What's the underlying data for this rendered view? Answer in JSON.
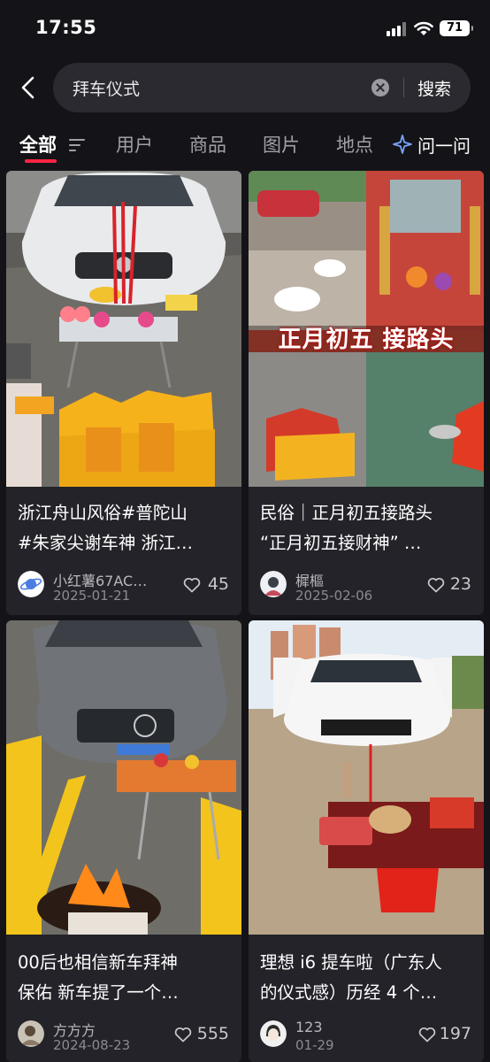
{
  "status_bar": {
    "time": "17:55",
    "battery": "71"
  },
  "search": {
    "query": "拜车仪式",
    "button_label": "搜索"
  },
  "tabs": [
    {
      "label": "全部"
    },
    {
      "label": "用户"
    },
    {
      "label": "商品"
    },
    {
      "label": "图片"
    },
    {
      "label": "地点"
    }
  ],
  "ask_button": {
    "label": "问一问"
  },
  "image_overlay_text": "正月初五 接路头",
  "cards": [
    {
      "title_line1": "浙江舟山风俗#普陀山",
      "title_line2": "#朱家尖谢车神 浙江…",
      "author": "小红薯67AC…",
      "date": "2025-01-21",
      "likes": "45"
    },
    {
      "title_line1": "民俗｜正月初五接路头",
      "title_line2": "“正月初五接财神” …",
      "author": "樨樞",
      "date": "2025-02-06",
      "likes": "23"
    },
    {
      "title_line1": "00后也相信新车拜神",
      "title_line2": "保佑 新车提了一个…",
      "author": "方方方",
      "date": "2024-08-23",
      "likes": "555"
    },
    {
      "title_line1": "理想 i6 提车啦（广东人",
      "title_line2": "的仪式感）历经 4 个…",
      "author": "123",
      "date": "01-29",
      "likes": "197"
    }
  ],
  "colors": {
    "accent": "#ff2442",
    "background": "#141418",
    "card": "#232329"
  }
}
